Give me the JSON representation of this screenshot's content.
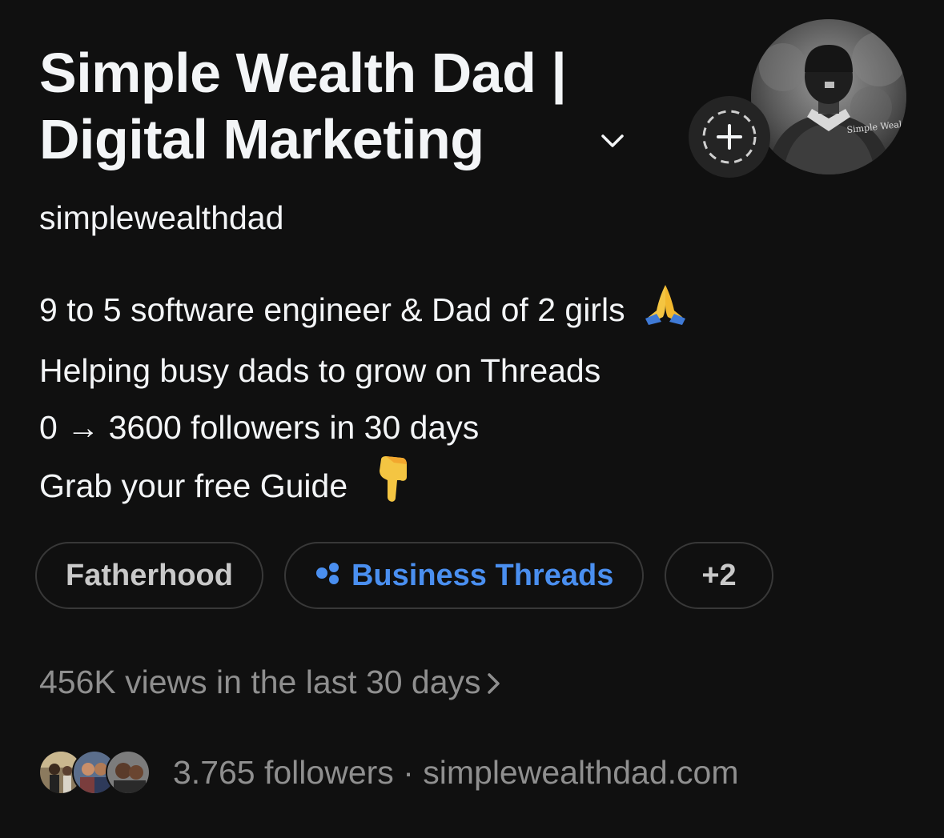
{
  "profile": {
    "display_name_line1": "Simple Wealth Dad |",
    "display_name_line2": "Digital Marketing",
    "username": "simplewealthdad",
    "avatar_caption": "Simple Wealth Dad"
  },
  "bio": {
    "line1": "9 to 5 software engineer & Dad of 2 girls",
    "line1_emoji": "folded-hands",
    "line2": "Helping busy dads to grow on Threads",
    "line3": "0 → 3600 followers in 30 days",
    "line4": "Grab your free Guide",
    "line4_emoji": "backhand-index-pointing-down"
  },
  "tags": {
    "tag1": "Fatherhood",
    "tag2": "Business Threads",
    "tag3": "+2"
  },
  "stats": {
    "views": "456K views in the last 30 days",
    "followers": "3.765 followers",
    "separator": "·",
    "website": "simplewealthdad.com"
  },
  "colors": {
    "background": "#101010",
    "primary_text": "#f3f5f7",
    "secondary_text": "#8f8f8f",
    "accent": "#4a8ff0"
  }
}
